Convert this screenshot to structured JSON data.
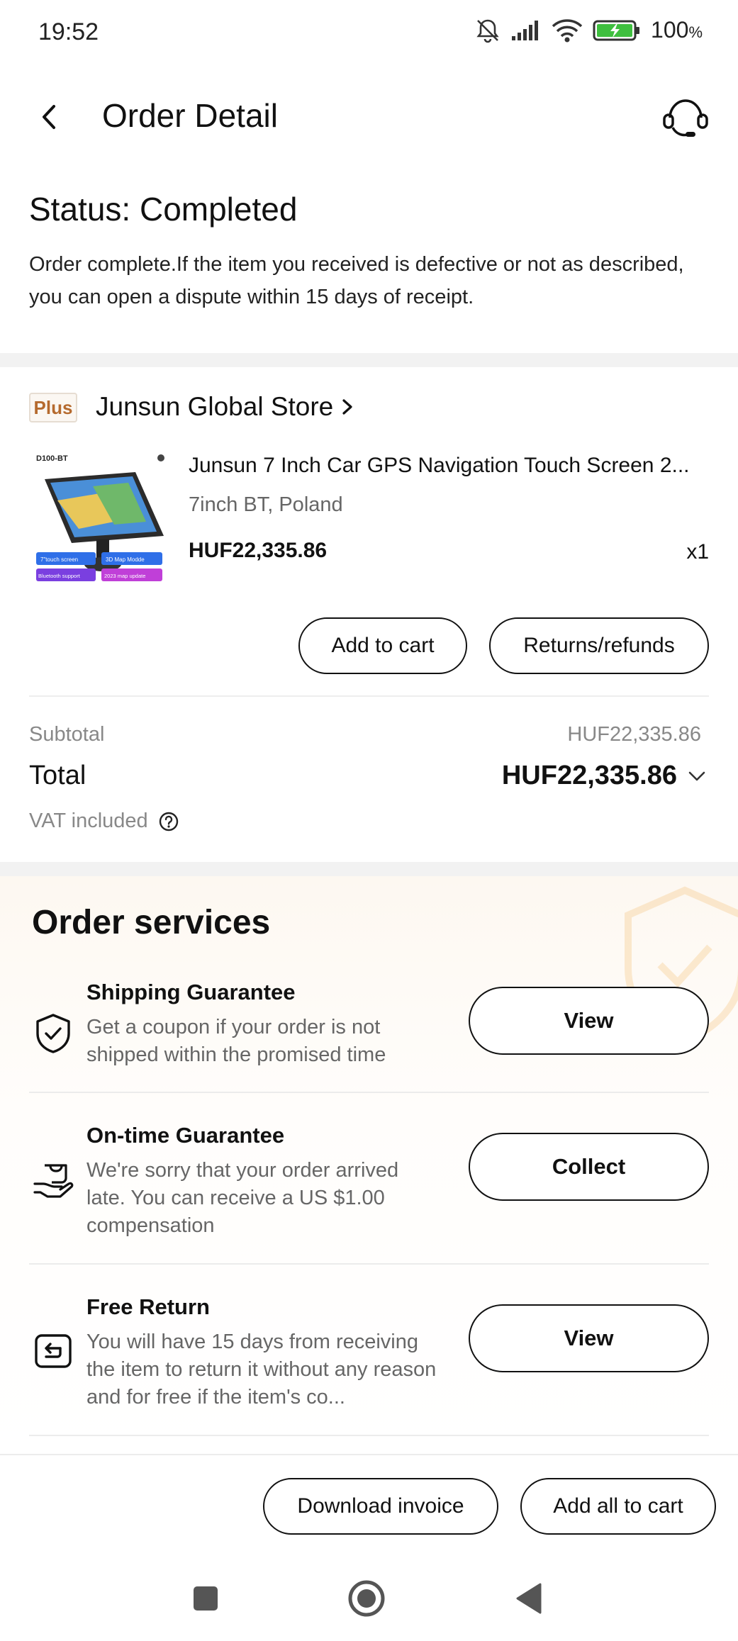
{
  "status_bar": {
    "time": "19:52",
    "battery": "100",
    "battery_unit": "%",
    "icons": [
      "bell-muted-icon",
      "signal-icon",
      "wifi-icon",
      "battery-charging-icon"
    ]
  },
  "header": {
    "title": "Order Detail",
    "back_icon": "chevron-left-icon",
    "support_icon": "headset-icon"
  },
  "status": {
    "title": "Status: Completed",
    "description": "Order complete.If the item you received is defective or not as described, you can open a dispute within 15 days of receipt."
  },
  "store": {
    "badge": "Plus",
    "name": "Junsun Global Store",
    "chevron": "›"
  },
  "product": {
    "title": "Junsun 7 Inch Car GPS Navigation Touch Screen 2...",
    "variant": "7inch BT, Poland",
    "price": "HUF22,335.86",
    "quantity": "x1",
    "image_labels": {
      "model": "D100-BT",
      "feature_1": "7\"touch screen",
      "feature_2": "3D Map Modde",
      "feature_3": "Bluetooth support",
      "feature_4": "2023 map update"
    }
  },
  "product_actions": {
    "add_to_cart": "Add to cart",
    "returns": "Returns/refunds"
  },
  "summary": {
    "subtotal_label": "Subtotal",
    "subtotal_value": "HUF22,335.86",
    "total_label": "Total",
    "total_value": "HUF22,335.86",
    "vat_label": "VAT included"
  },
  "services": {
    "title": "Order services",
    "items": [
      {
        "icon": "shield-check-icon",
        "name": "Shipping Guarantee",
        "description": "Get a coupon if your order is not shipped within the promised time",
        "button": "View"
      },
      {
        "icon": "hand-coin-icon",
        "name": "On-time Guarantee",
        "description": "We're sorry that your order arrived late. You can receive a US $1.00 compensation",
        "button": "Collect"
      },
      {
        "icon": "return-box-icon",
        "name": "Free Return",
        "description": "You will have 15 days from receiving the item to return it without any reason and for free if the item's co...",
        "button": "View"
      }
    ]
  },
  "bottom_actions": {
    "download_invoice": "Download invoice",
    "add_all_to_cart": "Add all to cart"
  },
  "nav_bar": {
    "recent_icon": "square-icon",
    "home_icon": "circle-icon",
    "back_icon": "triangle-back-icon"
  }
}
